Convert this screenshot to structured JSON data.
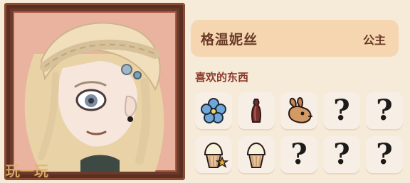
{
  "character": {
    "name": "格温妮丝",
    "title": "公主"
  },
  "favorites": {
    "section_label": "喜欢的东西",
    "items": [
      {
        "type": "flower",
        "icon": "blue-flower-icon"
      },
      {
        "type": "statuette",
        "icon": "bottle-statue-icon"
      },
      {
        "type": "rabbit",
        "icon": "rabbit-icon"
      },
      {
        "type": "unknown",
        "icon": "question-mark-icon",
        "label": "?"
      },
      {
        "type": "unknown",
        "icon": "question-mark-icon",
        "label": "?"
      },
      {
        "type": "cupcake",
        "icon": "cupcake-star-icon"
      },
      {
        "type": "cupcake",
        "icon": "cupcake-icon"
      },
      {
        "type": "unknown",
        "icon": "question-mark-icon",
        "label": "?"
      },
      {
        "type": "unknown",
        "icon": "question-mark-icon",
        "label": "?"
      },
      {
        "type": "unknown",
        "icon": "question-mark-icon",
        "label": "?"
      }
    ]
  },
  "watermark": "玩一玩",
  "colors": {
    "background": "#f6ead8",
    "name_panel": "#f5d6b1",
    "frame": "#6b3a2a",
    "text_brown": "#6a3a26",
    "section_red": "#8b3a2c"
  }
}
